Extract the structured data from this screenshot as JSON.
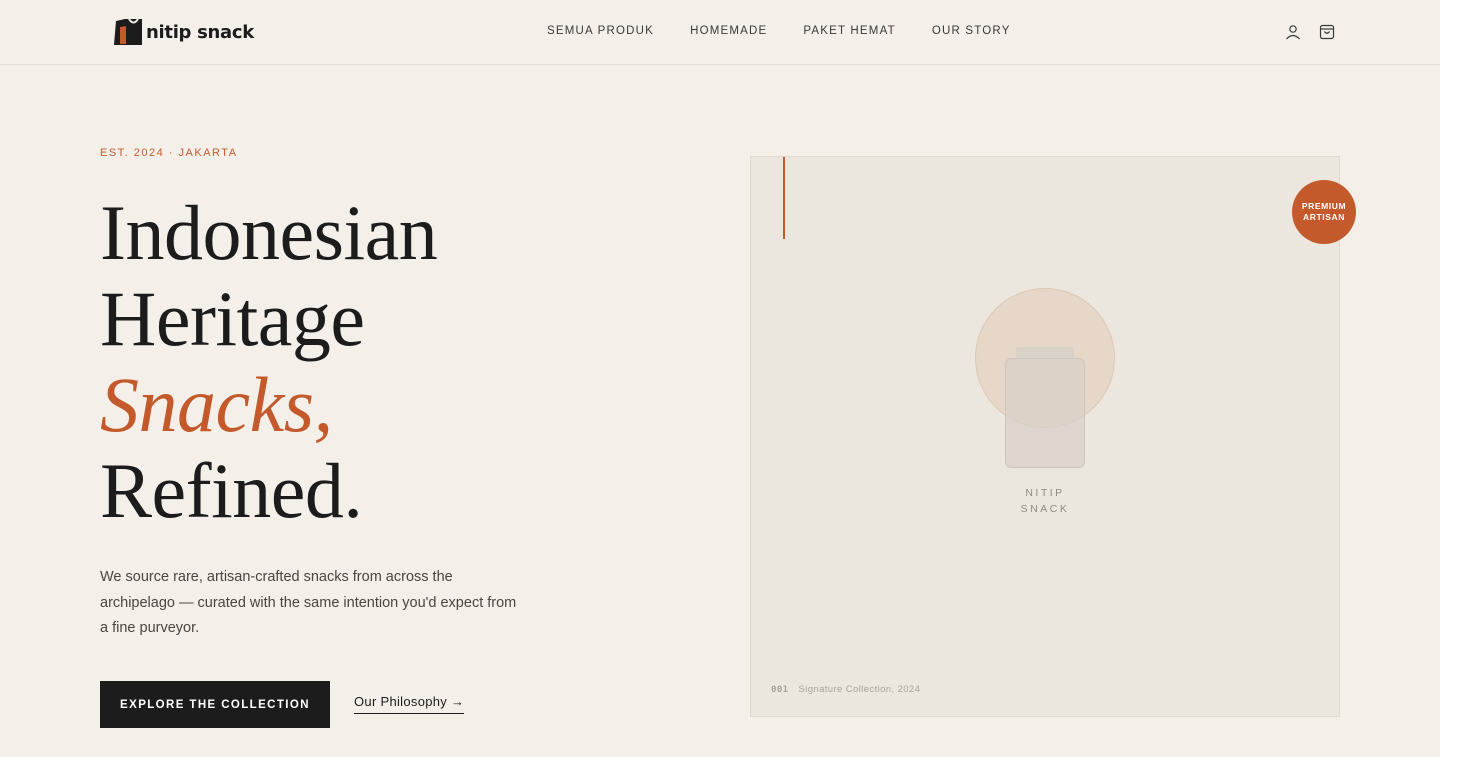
{
  "brand": {
    "name": "nitip snack",
    "logo_icon": "paper-bag-icon"
  },
  "nav": {
    "items": [
      {
        "label": "SEMUA PRODUK"
      },
      {
        "label": "HOMEMADE"
      },
      {
        "label": "PAKET HEMAT"
      },
      {
        "label": "OUR STORY"
      }
    ]
  },
  "header_icons": {
    "account": "user-icon",
    "cart": "shopping-bag-icon"
  },
  "hero": {
    "eyebrow": "EST. 2024 · JAKARTA",
    "headline": {
      "line1": "Indonesian",
      "line2": "Heritage",
      "line3_accent": "Snacks,",
      "line4": "Refined."
    },
    "lede": "We source rare, artisan-crafted snacks from across the archipelago — curated with the same intention you'd expect from a fine purveyor.",
    "cta_primary": "EXPLORE THE COLLECTION",
    "cta_secondary": "Our Philosophy →"
  },
  "feature_card": {
    "badge_line1": "PREMIUM",
    "badge_line2": "ARTISAN",
    "jar_label_line1": "NITIP",
    "jar_label_line2": "SNACK",
    "caption_number": "001",
    "caption_text": "Signature Collection, 2024"
  },
  "colors": {
    "background": "#f4efe8",
    "accent": "#c45a2c",
    "ink": "#1c1c1c",
    "card": "#ebe6de"
  }
}
